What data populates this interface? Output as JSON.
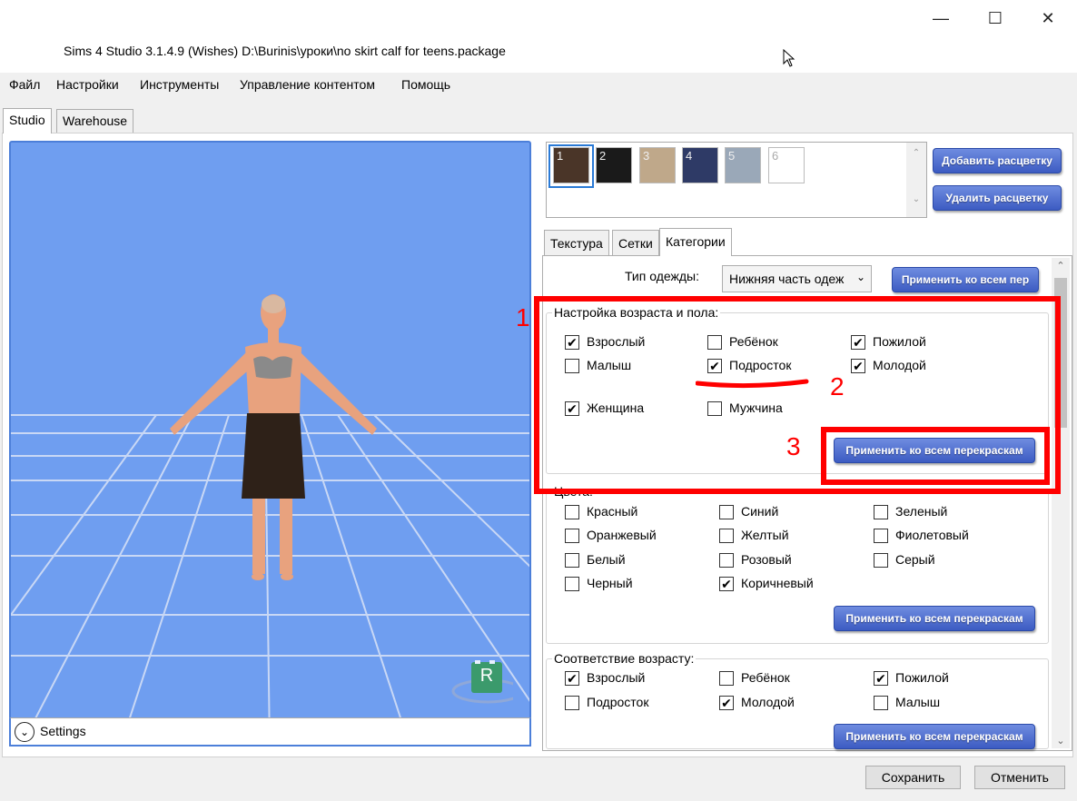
{
  "window": {
    "title": "Sims 4 Studio 3.1.4.9 (Wishes)  D:\\Burinis\\уроки\\no skirt calf for teens.package",
    "minimize": "—",
    "maximize": "☐",
    "close": "✕"
  },
  "menu": [
    "Файл",
    "Настройки",
    "Инструменты",
    "Управление контентом",
    "Помощь"
  ],
  "main_tabs": [
    "Studio",
    "Warehouse"
  ],
  "viewport": {
    "settings_label": "Settings",
    "badge_letter": "R"
  },
  "swatches": [
    {
      "num": "1",
      "color": "#4a3528"
    },
    {
      "num": "2",
      "color": "#1a1a1a"
    },
    {
      "num": "3",
      "color": "#bfa88a"
    },
    {
      "num": "4",
      "color": "#2e3a66"
    },
    {
      "num": "5",
      "color": "#9aa8b8"
    },
    {
      "num": "6",
      "color": "#ffffff"
    }
  ],
  "swatch_buttons": {
    "add": "Добавить расцветку",
    "remove": "Удалить расцветку"
  },
  "right_tabs": [
    "Текстура",
    "Сетки",
    "Категории"
  ],
  "clothing_type": {
    "label": "Тип одежды:",
    "value": "Нижняя часть одеж",
    "apply": "Применить ко всем пер"
  },
  "age_gender": {
    "title": "Настройка возраста и пола:",
    "items": [
      {
        "label": "Взрослый",
        "checked": true
      },
      {
        "label": "Ребёнок",
        "checked": false
      },
      {
        "label": "Пожилой",
        "checked": true
      },
      {
        "label": "Малыш",
        "checked": false
      },
      {
        "label": "Подросток",
        "checked": true
      },
      {
        "label": "Молодой",
        "checked": true
      },
      {
        "label": "Женщина",
        "checked": true
      },
      {
        "label": "Мужчина",
        "checked": false
      }
    ],
    "apply": "Применить ко всем перекраскам"
  },
  "colors": {
    "title": "Цвета:",
    "items": [
      {
        "label": "Красный",
        "checked": false
      },
      {
        "label": "Синий",
        "checked": false
      },
      {
        "label": "Зеленый",
        "checked": false
      },
      {
        "label": "Оранжевый",
        "checked": false
      },
      {
        "label": "Желтый",
        "checked": false
      },
      {
        "label": "Фиолетовый",
        "checked": false
      },
      {
        "label": "Белый",
        "checked": false
      },
      {
        "label": "Розовый",
        "checked": false
      },
      {
        "label": "Серый",
        "checked": false
      },
      {
        "label": "Черный",
        "checked": false
      },
      {
        "label": "Коричневый",
        "checked": true
      }
    ],
    "apply": "Применить ко всем перекраскам"
  },
  "age_match": {
    "title": "Соответствие возрасту:",
    "items": [
      {
        "label": "Взрослый",
        "checked": true
      },
      {
        "label": "Ребёнок",
        "checked": false
      },
      {
        "label": "Пожилой",
        "checked": true
      },
      {
        "label": "Подросток",
        "checked": false
      },
      {
        "label": "Молодой",
        "checked": true
      },
      {
        "label": "Малыш",
        "checked": false
      }
    ],
    "apply": "Применить ко всем перекраскам"
  },
  "annotations": [
    "1",
    "2",
    "3"
  ],
  "footer": {
    "save": "Сохранить",
    "cancel": "Отменить"
  },
  "checkmark": "✔"
}
